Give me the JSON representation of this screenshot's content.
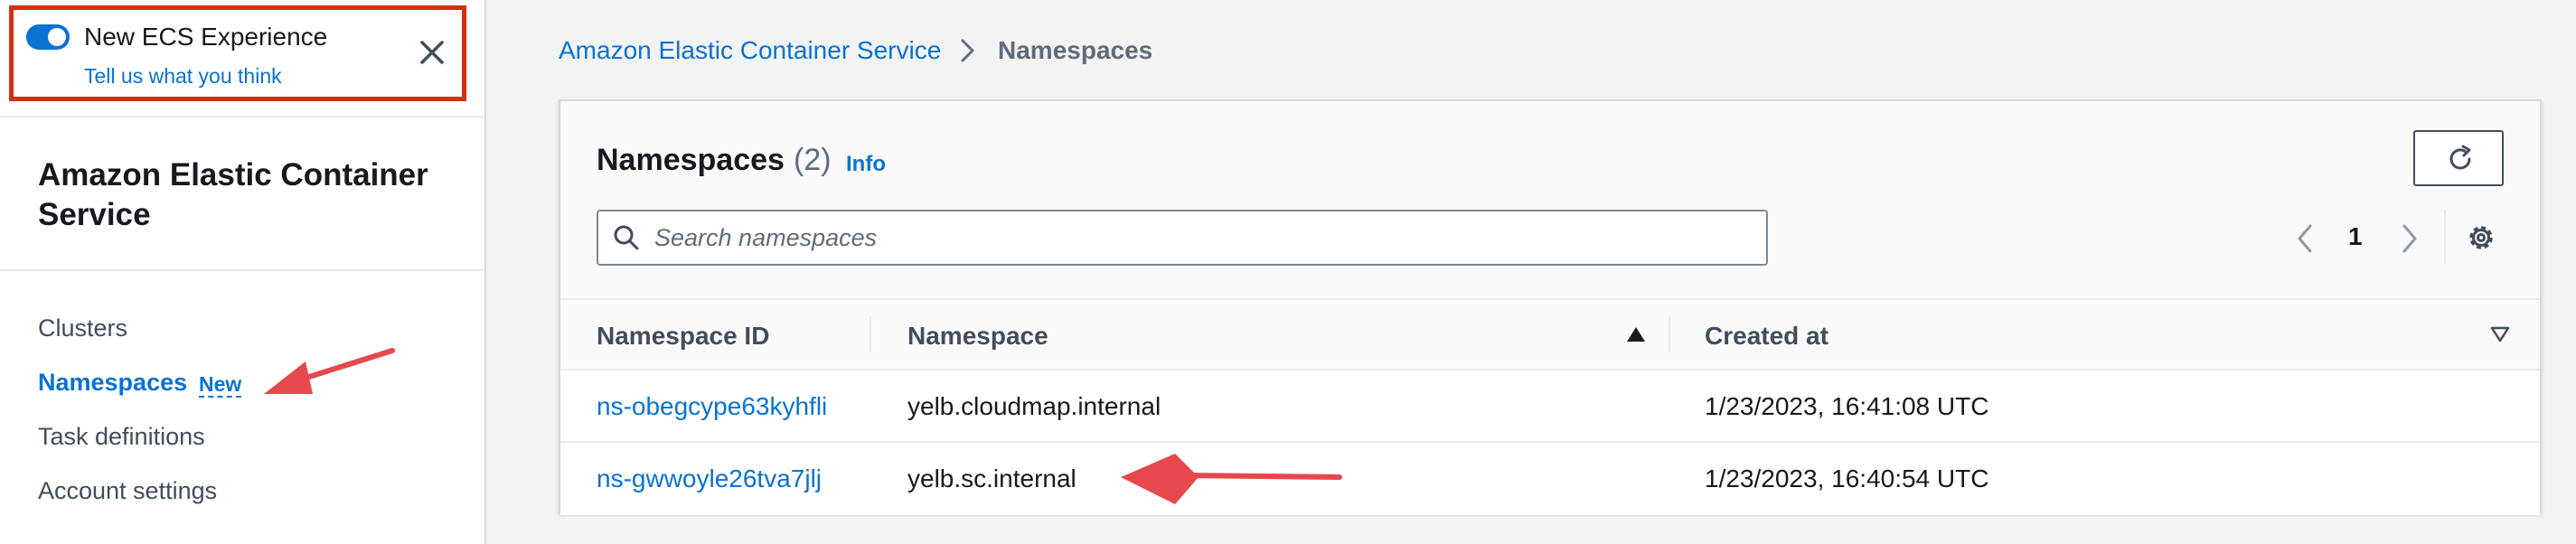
{
  "banner": {
    "toggle_state": "on",
    "title": "New ECS Experience",
    "feedback_link": "Tell us what you think"
  },
  "sidebar": {
    "service_title": "Amazon Elastic Container Service",
    "items": [
      {
        "label": "Clusters",
        "active": false
      },
      {
        "label": "Namespaces",
        "active": true,
        "badge": "New"
      },
      {
        "label": "Task definitions",
        "active": false
      },
      {
        "label": "Account settings",
        "active": false
      }
    ]
  },
  "breadcrumb": {
    "parent": "Amazon Elastic Container Service",
    "current": "Namespaces"
  },
  "panel": {
    "title": "Namespaces",
    "count": "(2)",
    "info": "Info",
    "search_placeholder": "Search namespaces",
    "page": "1"
  },
  "table": {
    "headers": [
      "Namespace ID",
      "Namespace",
      "Created at"
    ],
    "rows": [
      {
        "id": "ns-obegcype63kyhfli",
        "namespace": "yelb.cloudmap.internal",
        "created": "1/23/2023, 16:41:08 UTC"
      },
      {
        "id": "ns-gwwoyle26tva7jlj",
        "namespace": "yelb.sc.internal",
        "created": "1/23/2023, 16:40:54 UTC"
      }
    ]
  },
  "colors": {
    "accent": "#0972d3",
    "annotation": "#e5484d",
    "highlight_border": "#d13212"
  }
}
